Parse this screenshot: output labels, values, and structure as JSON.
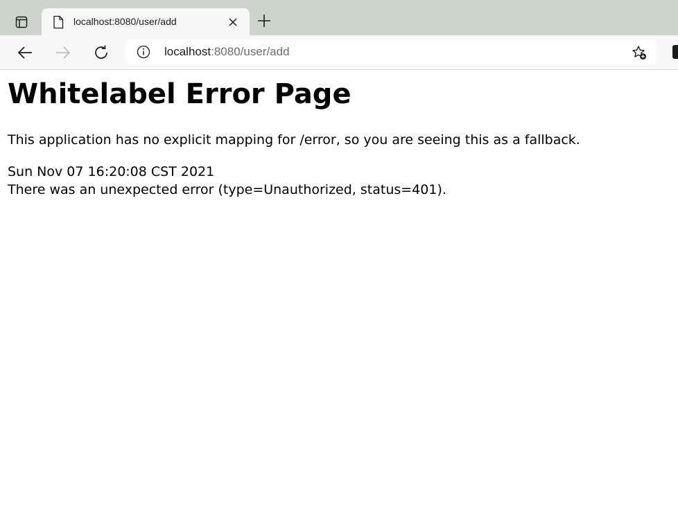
{
  "browser": {
    "tab": {
      "title": "localhost:8080/user/add"
    },
    "address_bar": {
      "host": "localhost",
      "path": ":8080/user/add"
    }
  },
  "page": {
    "title": "Whitelabel Error Page",
    "description": "This application has no explicit mapping for /error, so you are seeing this as a fallback.",
    "timestamp": "Sun Nov 07 16:20:08 CST 2021",
    "error_message": "There was an unexpected error (type=Unauthorized, status=401)."
  },
  "icons": {
    "tab_actions": "tab-actions-icon",
    "favicon": "document-icon",
    "close": "close-icon",
    "new_tab": "plus-icon",
    "back": "back-arrow-icon",
    "forward": "forward-arrow-icon",
    "reload": "reload-icon",
    "info": "info-icon",
    "favorites": "favorites-add-icon",
    "profile": "profile-icon"
  }
}
